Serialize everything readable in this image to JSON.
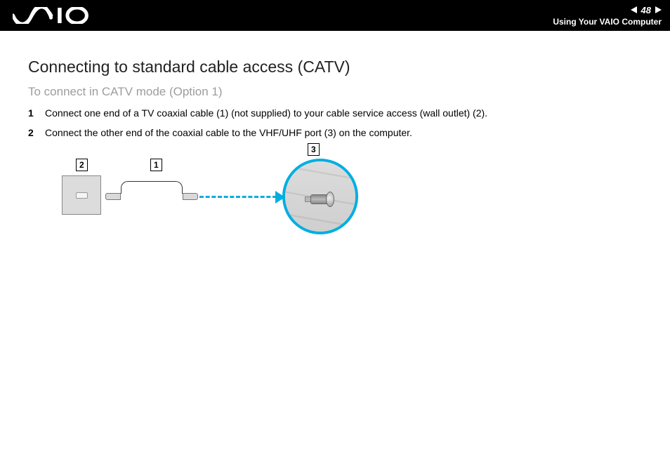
{
  "header": {
    "page_number": "48",
    "section_title": "Using Your VAIO Computer",
    "logo_alt": "VAIO"
  },
  "content": {
    "heading": "Connecting to standard cable access (CATV)",
    "subheading": "To connect in CATV mode (Option 1)",
    "steps": [
      {
        "num": "1",
        "text": "Connect one end of a TV coaxial cable (1) (not supplied) to your cable service access (wall outlet) (2)."
      },
      {
        "num": "2",
        "text": "Connect the other end of the coaxial cable to the VHF/UHF port (3) on the computer."
      }
    ]
  },
  "diagram": {
    "callouts": {
      "c1": "1",
      "c2": "2",
      "c3": "3"
    },
    "accent_color": "#00aee0"
  }
}
